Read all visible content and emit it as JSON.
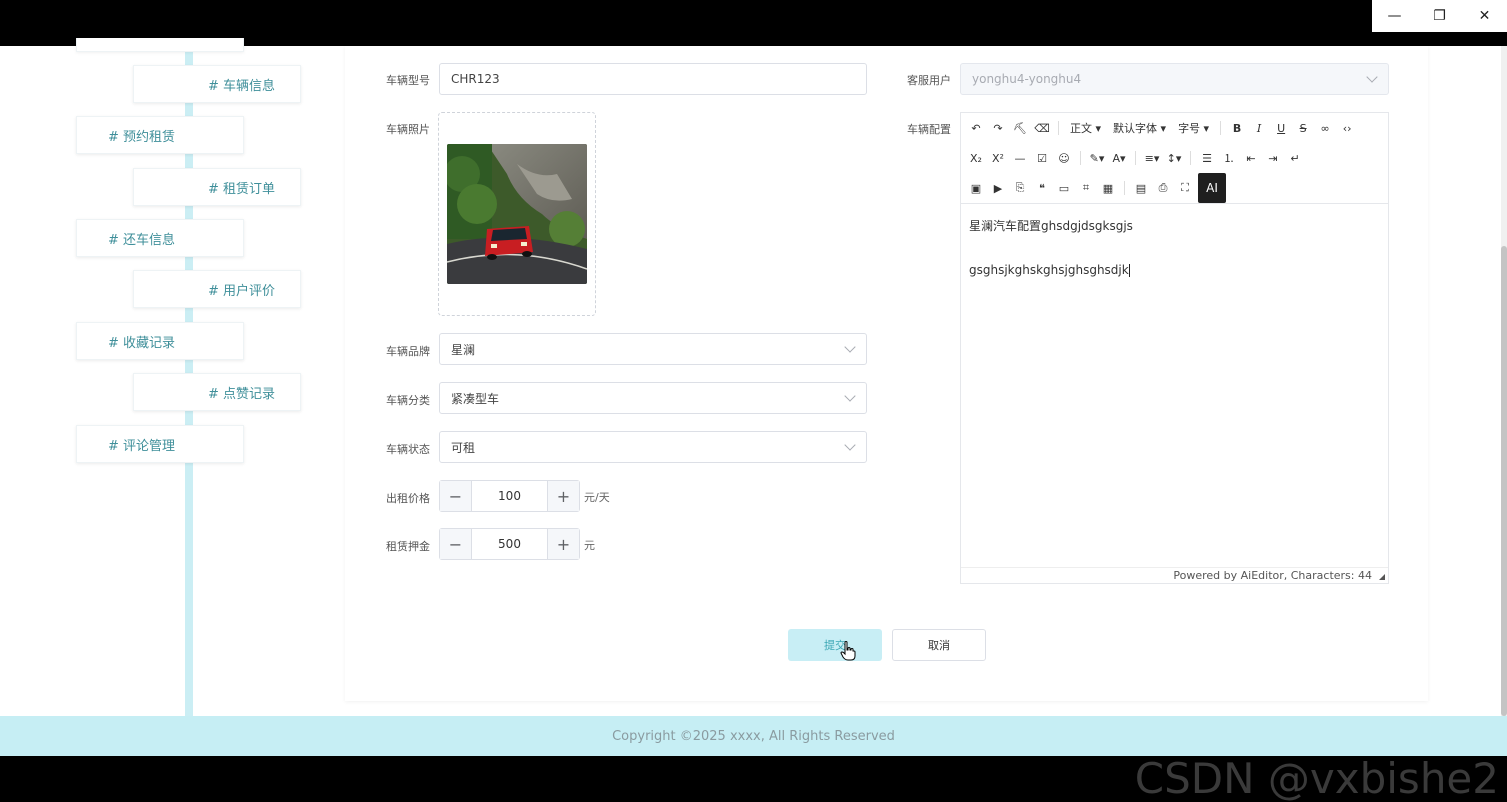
{
  "window": {
    "minimize_glyph": "—",
    "restore_glyph": "❐",
    "close_glyph": "✕"
  },
  "sidebar": {
    "items": [
      {
        "label": "# 车辆信息",
        "level": "sub"
      },
      {
        "label": "# 预约租赁",
        "level": "main"
      },
      {
        "label": "# 租赁订单",
        "level": "sub"
      },
      {
        "label": "# 还车信息",
        "level": "main"
      },
      {
        "label": "# 用户评价",
        "level": "sub"
      },
      {
        "label": "# 收藏记录",
        "level": "main"
      },
      {
        "label": "# 点赞记录",
        "level": "sub"
      },
      {
        "label": "# 评论管理",
        "level": "main"
      }
    ]
  },
  "form": {
    "model_label": "车辆型号",
    "model_value": "CHR123",
    "photo_label": "车辆照片",
    "brand_label": "车辆品牌",
    "brand_value": "星澜",
    "category_label": "车辆分类",
    "category_value": "紧凑型车",
    "status_label": "车辆状态",
    "status_value": "可租",
    "price_label": "出租价格",
    "price_value": "100",
    "price_unit": "元/天",
    "deposit_label": "租赁押金",
    "deposit_value": "500",
    "deposit_unit": "元",
    "service_user_label": "客服用户",
    "service_user_value": "yonghu4-yonghu4",
    "config_label": "车辆配置"
  },
  "editor": {
    "toolbar": {
      "paragraph": "正文",
      "font_family": "默认字体",
      "font_size": "字号",
      "ai": "AI"
    },
    "content_line1": "星澜汽车配置ghsdgjdsgksgjs",
    "content_line2": "gsghsjkghskghsjghsghsdjk",
    "footer": "Powered by AiEditor, Characters: 44"
  },
  "buttons": {
    "submit": "提交",
    "cancel": "取消"
  },
  "footer": {
    "copyright": "Copyright ©2025 xxxx, All Rights Reserved"
  },
  "watermark": "CSDN @vxbishe2",
  "colors": {
    "accent": "#c6eef4",
    "link": "#3f8f9a",
    "submit_text": "#3aa6b4"
  }
}
